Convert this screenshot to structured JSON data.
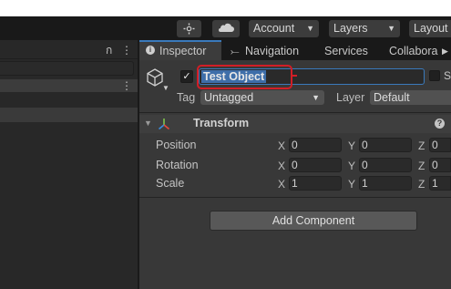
{
  "toolbar": {
    "account_label": "Account",
    "layers_label": "Layers",
    "layout_label": "Layout"
  },
  "left_panel": {
    "lock_glyph": "ก",
    "menu_glyph": "⋮"
  },
  "inspector": {
    "tabs": [
      {
        "label": "Inspector",
        "icon": "info-icon"
      },
      {
        "label": "Navigation",
        "icon": "navigation-icon"
      },
      {
        "label": "Services"
      },
      {
        "label": "Collabora"
      }
    ],
    "active_checkbox": "✓",
    "object_name": "Test Object",
    "static_label": "S",
    "tag_label": "Tag",
    "tag_value": "Untagged",
    "layer_label": "Layer",
    "layer_value": "Default",
    "transform": {
      "title": "Transform",
      "rows": [
        {
          "label": "Position",
          "x": "0",
          "y": "0",
          "z": "0"
        },
        {
          "label": "Rotation",
          "x": "0",
          "y": "0",
          "z": "0"
        },
        {
          "label": "Scale",
          "x": "1",
          "y": "1",
          "z": "1"
        }
      ],
      "axes": {
        "x": "X",
        "y": "Y",
        "z": "Z"
      }
    },
    "add_component_label": "Add Component"
  },
  "colors": {
    "accent": "#3a79bb",
    "selection": "#3e6ea9",
    "annotation": "#d21e26"
  }
}
